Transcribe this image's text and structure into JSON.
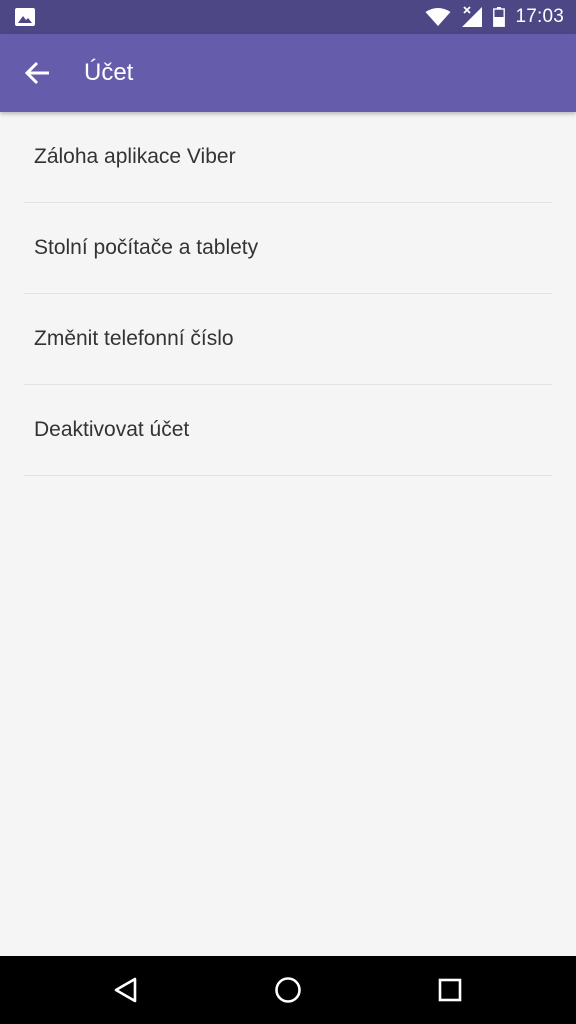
{
  "status_bar": {
    "time": "17:03",
    "icons": [
      "image-notification-icon",
      "wifi-icon",
      "signal-icon",
      "battery-icon"
    ]
  },
  "app_bar": {
    "title": "Účet",
    "back_icon": "arrow-back-icon",
    "color": "#665cac"
  },
  "menu": {
    "items": [
      {
        "label": "Záloha aplikace Viber"
      },
      {
        "label": "Stolní počítače a tablety"
      },
      {
        "label": "Změnit telefonní číslo"
      },
      {
        "label": "Deaktivovat účet"
      }
    ]
  },
  "nav_bar": {
    "buttons": [
      "back-triangle-icon",
      "home-circle-icon",
      "recents-square-icon"
    ]
  }
}
